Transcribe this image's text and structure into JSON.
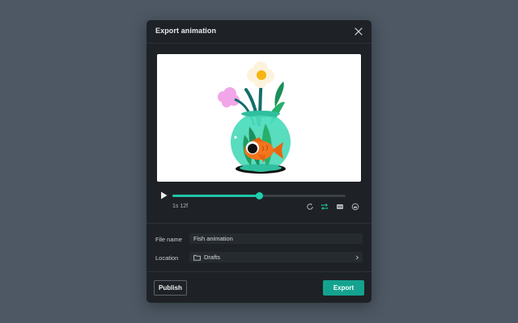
{
  "dialog": {
    "title": "Export animation",
    "close_icon": "close-icon"
  },
  "preview": {
    "artwork": "fish-bowl-illustration"
  },
  "player": {
    "play_icon": "play-icon",
    "progress": 0.5,
    "time": "1s 12f",
    "controls": [
      {
        "name": "replay-icon",
        "active": false
      },
      {
        "name": "loop-icon",
        "active": true
      },
      {
        "name": "subtitles-icon",
        "active": false
      },
      {
        "name": "audio-icon",
        "active": false
      }
    ]
  },
  "form": {
    "file_name_label": "File name",
    "file_name_value": "Fish animation",
    "location_label": "Location",
    "location_value": "Drafts",
    "location_icon": "folder-icon",
    "location_chevron": "chevron-right-icon"
  },
  "footer": {
    "publish_label": "Publish",
    "export_label": "Export"
  },
  "colors": {
    "accent": "#1fc6a8",
    "export_button": "#14a38f",
    "dialog_bg": "#1e2226",
    "backdrop": "#4d5864"
  }
}
